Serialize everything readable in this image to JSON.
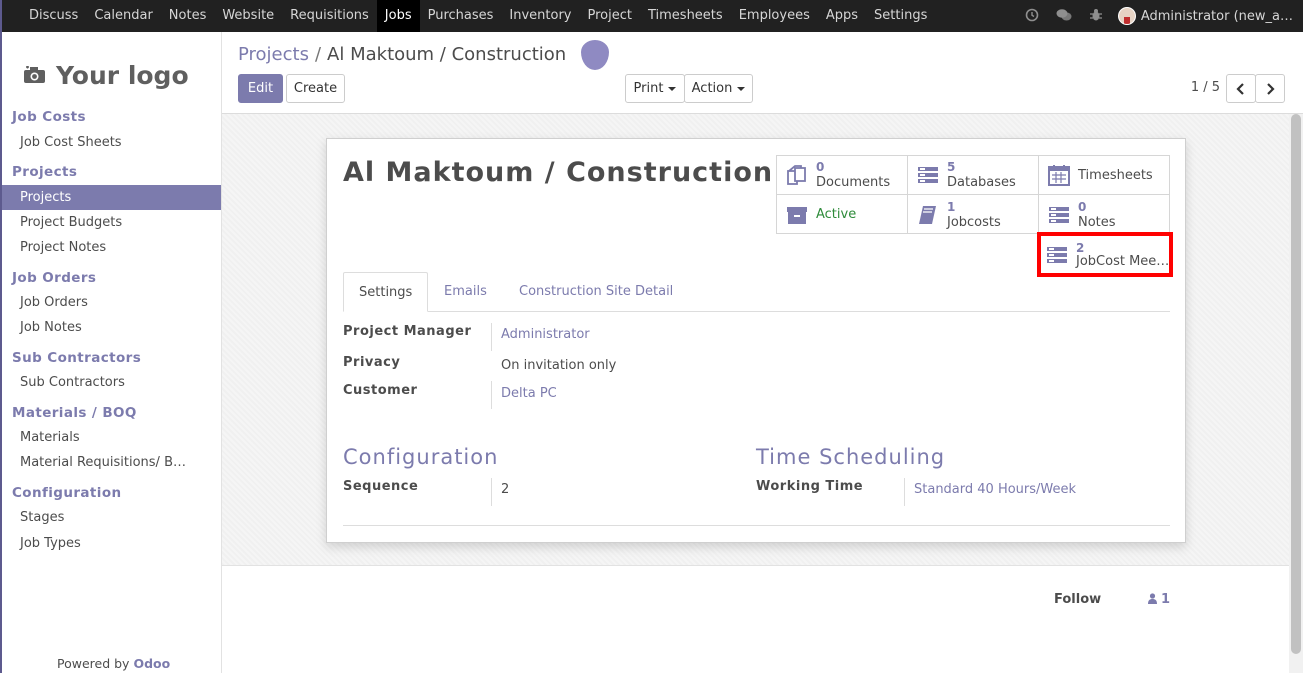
{
  "topnav": {
    "menu": [
      "Discuss",
      "Calendar",
      "Notes",
      "Website",
      "Requisitions",
      "Jobs",
      "Purchases",
      "Inventory",
      "Project",
      "Timesheets",
      "Employees",
      "Apps",
      "Settings"
    ],
    "active": "Jobs",
    "user": "Administrator (new_a…"
  },
  "sidebar": {
    "logo": "Your logo",
    "sections": [
      {
        "title": "Job Costs",
        "items": [
          "Job Cost Sheets"
        ]
      },
      {
        "title": "Projects",
        "items": [
          "Projects",
          "Project Budgets",
          "Project Notes"
        ]
      },
      {
        "title": "Job Orders",
        "items": [
          "Job Orders",
          "Job Notes"
        ]
      },
      {
        "title": "Sub Contractors",
        "items": [
          "Sub Contractors"
        ]
      },
      {
        "title": "Materials / BOQ",
        "items": [
          "Materials",
          "Material Requisitions/ B…"
        ]
      },
      {
        "title": "Configuration",
        "items": [
          "Stages",
          "Job Types"
        ]
      }
    ],
    "active_item": "Projects",
    "powered_by": "Powered by",
    "powered_brand": "Odoo"
  },
  "control_panel": {
    "breadcrumb": [
      "Projects",
      "Al Maktoum / Construction"
    ],
    "edit": "Edit",
    "create": "Create",
    "print": "Print",
    "action": "Action",
    "pager": "1 / 5"
  },
  "form": {
    "title": "Al Maktoum / Construction",
    "smart_buttons": {
      "documents": {
        "count": "0",
        "label": "Documents"
      },
      "databases": {
        "count": "5",
        "label": "Databases"
      },
      "timesheets": {
        "label": "Timesheets"
      },
      "active": {
        "label": "Active"
      },
      "jobcosts": {
        "count": "1",
        "label": "Jobcosts"
      },
      "notes": {
        "count": "0",
        "label": "Notes"
      },
      "jobcost_meetings": {
        "count": "2",
        "label": "JobCost Mee…"
      }
    },
    "tabs": [
      "Settings",
      "Emails",
      "Construction Site Detail"
    ],
    "fields": {
      "project_manager_label": "Project Manager",
      "project_manager": "Administrator",
      "privacy_label": "Privacy",
      "privacy": "On invitation only",
      "customer_label": "Customer",
      "customer": "Delta PC"
    },
    "configuration": {
      "title": "Configuration",
      "sequence_label": "Sequence",
      "sequence": "2"
    },
    "time_scheduling": {
      "title": "Time Scheduling",
      "working_time_label": "Working Time",
      "working_time": "Standard 40 Hours/Week"
    }
  },
  "chatter": {
    "follow": "Follow",
    "followers_count": "1"
  },
  "colors": {
    "accent": "#7c7bad",
    "topbar": "#212121",
    "highlight": "#ff0000",
    "active_status": "#2e8b3a"
  }
}
